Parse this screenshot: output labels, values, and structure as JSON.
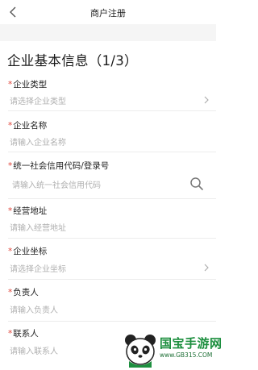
{
  "header": {
    "title": "商户注册",
    "back_icon": "back-arrow-icon"
  },
  "section": {
    "title": "企业基本信息（1/3）"
  },
  "fields": [
    {
      "label": "企业类型",
      "required_mark": "*",
      "placeholder": "请选择企业类型",
      "trailing_icon": "chevron-right-icon"
    },
    {
      "label": "企业名称",
      "required_mark": "*",
      "placeholder": "请输入企业名称"
    },
    {
      "label": "统一社会信用代码/登录号",
      "required_mark": "*",
      "placeholder": "请输入统一社会信用代码",
      "trailing_icon": "search-icon"
    },
    {
      "label": "经营地址",
      "required_mark": "*",
      "placeholder": "请输入经营地址"
    },
    {
      "label": "企业坐标",
      "required_mark": "*",
      "placeholder": "请选择企业坐标",
      "trailing_icon": "chevron-right-icon"
    },
    {
      "label": "负责人",
      "required_mark": "*",
      "placeholder": "请输入负责人"
    },
    {
      "label": "联系人",
      "required_mark": "*",
      "placeholder": "请输入联系人"
    }
  ],
  "watermark": {
    "brand": "国宝手游网",
    "url": "www.GB315.COM"
  },
  "colors": {
    "required": "#e0453a",
    "placeholder": "#b0b0b0",
    "background_band": "#f5f5f5",
    "watermark_green": "#1d8f3f"
  }
}
